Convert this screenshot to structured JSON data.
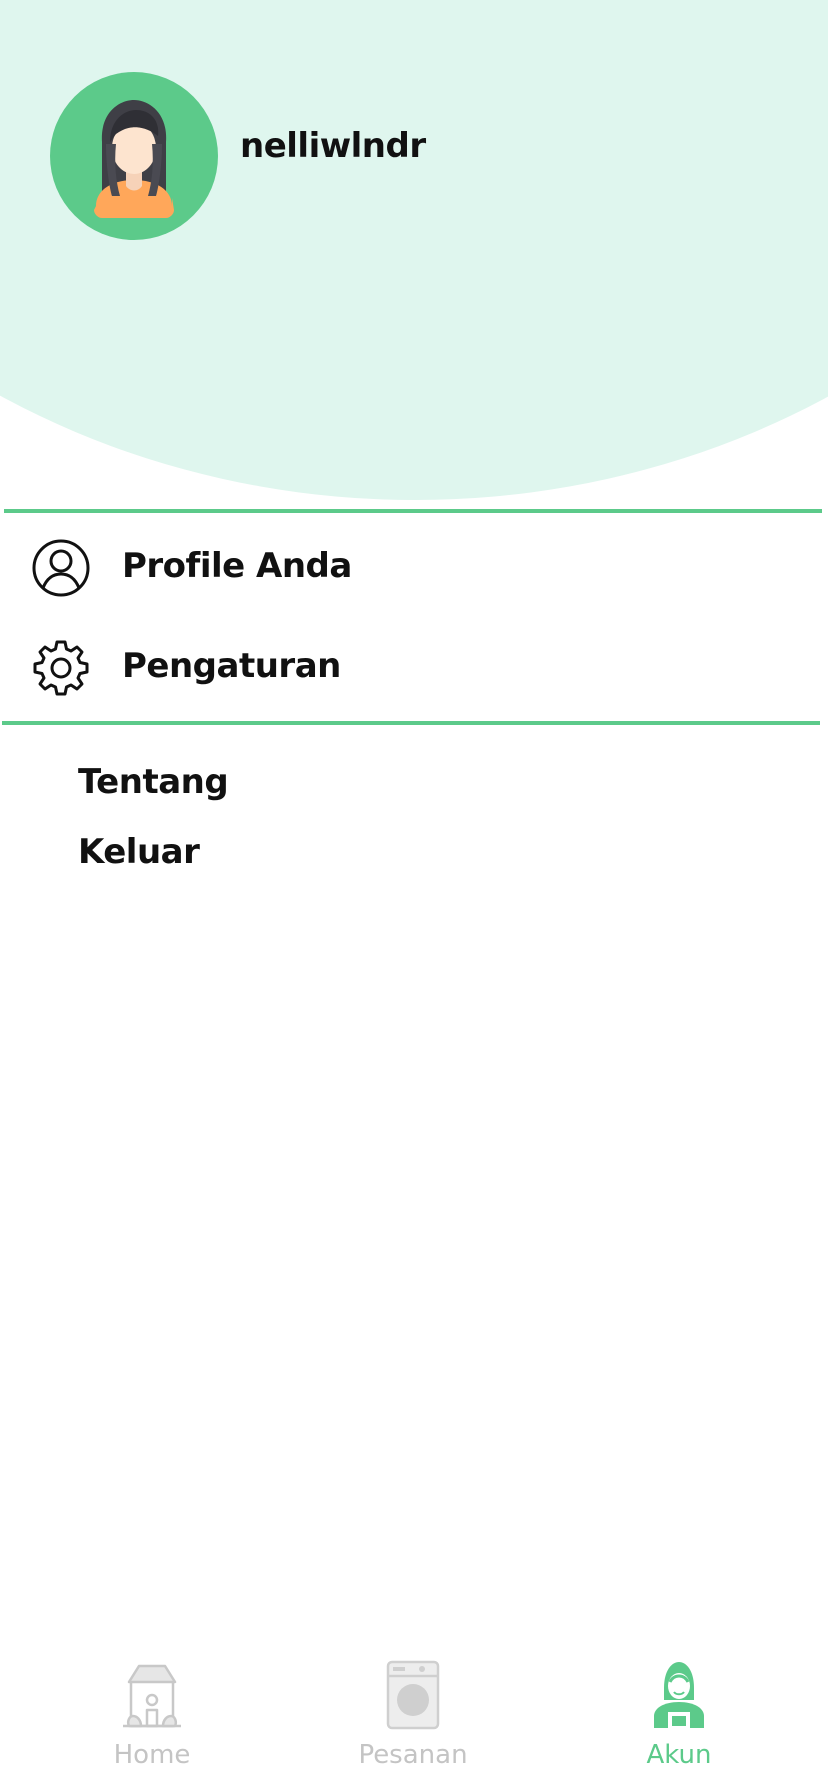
{
  "colors": {
    "accent": "#5cca8a",
    "header_bg": "#dff6ee",
    "inactive": "#c4c4c4",
    "text": "#111111"
  },
  "profile": {
    "username": "nelliwlndr",
    "avatar_icon": "woman-avatar-icon"
  },
  "menu": {
    "items": [
      {
        "label": "Profile Anda",
        "icon": "user-circle-icon"
      },
      {
        "label": "Pengaturan",
        "icon": "gear-icon"
      }
    ],
    "links": [
      {
        "label": "Tentang"
      },
      {
        "label": "Keluar"
      }
    ]
  },
  "bottom_nav": {
    "items": [
      {
        "label": "Home",
        "icon": "house-icon",
        "active": false
      },
      {
        "label": "Pesanan",
        "icon": "washing-machine-icon",
        "active": false
      },
      {
        "label": "Akun",
        "icon": "woman-worker-icon",
        "active": true
      }
    ]
  }
}
